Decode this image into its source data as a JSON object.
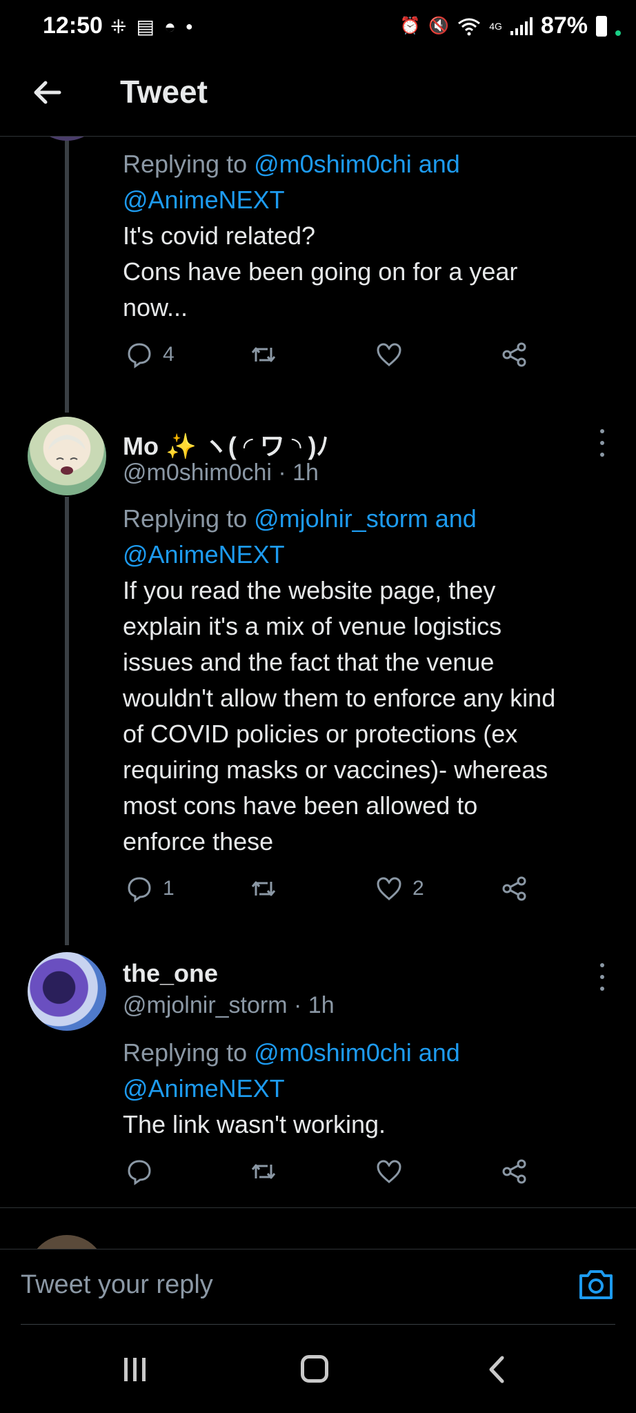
{
  "status_bar": {
    "time": "12:50",
    "battery": "87%",
    "network": "4G",
    "left_icons": [
      "slack-icon",
      "news-icon",
      "snapchat-icon",
      "dot-icon"
    ],
    "right_icons": [
      "alarm-icon",
      "mute-icon",
      "wifi-icon",
      "signal-icon",
      "battery-icon"
    ]
  },
  "header": {
    "title": "Tweet"
  },
  "tweets": [
    {
      "reply_prefix": "Replying to",
      "reply_mentions": "@m0shim0chi and",
      "reply_mentions_2": "@AnimeNEXT",
      "lines": [
        "It's covid related?",
        "Cons have been going on for a year",
        "now..."
      ],
      "reply_count": "4",
      "retweet_count": "",
      "like_count": ""
    },
    {
      "name": "Mo ✨ ヽ( ◜ ワ ◝ )ﾉ",
      "handle": "@m0shim0chi",
      "time": "· 1h",
      "reply_prefix": "Replying to",
      "reply_mentions": "@mjolnir_storm and",
      "reply_mentions_2": "@AnimeNEXT",
      "lines": [
        "If you read the website page, they",
        "explain it's a mix of venue logistics",
        "issues and the fact that the venue",
        "wouldn't allow them to enforce any kind",
        "of COVID policies or protections (ex",
        "requiring masks or vaccines)- whereas",
        "most cons have been allowed to",
        "enforce these"
      ],
      "reply_count": "1",
      "retweet_count": "",
      "like_count": "2"
    },
    {
      "name": "the_one",
      "handle": "@mjolnir_storm",
      "time": "· 1h",
      "reply_prefix": "Replying to",
      "reply_mentions": "@m0shim0chi and",
      "reply_mentions_2": "@AnimeNEXT",
      "lines": [
        "The link wasn't working."
      ],
      "reply_count": "",
      "retweet_count": "",
      "like_count": ""
    }
  ],
  "composer": {
    "placeholder": "Tweet your reply"
  },
  "colors": {
    "background": "#000000",
    "text": "#e7e9ea",
    "muted": "#8b98a5",
    "accent": "#1d9bf0",
    "divider": "#2f3336"
  }
}
